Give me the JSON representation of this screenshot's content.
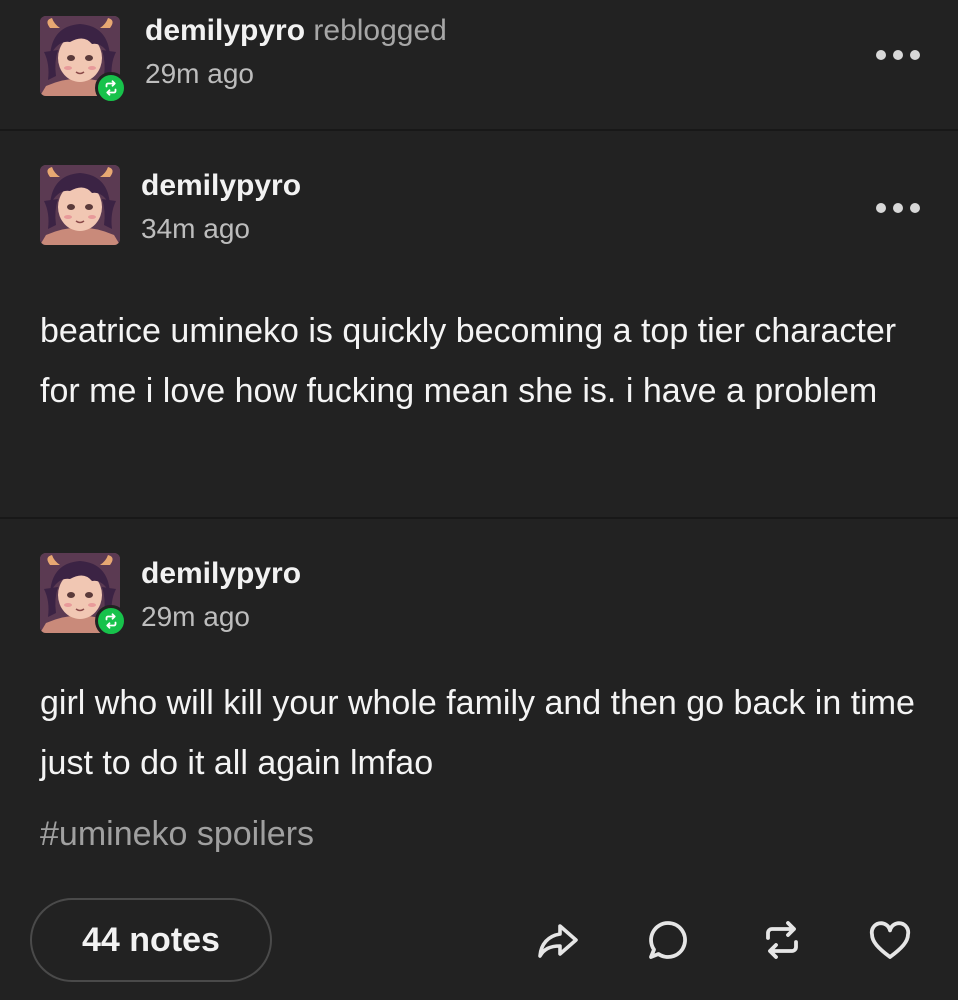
{
  "reblog_header": {
    "username": "demilypyro",
    "verb": "reblogged",
    "time": "29m ago"
  },
  "original_post": {
    "username": "demilypyro",
    "time": "34m ago",
    "body": "beatrice umineko is quickly becoming a top tier character for me i love how fucking mean she is. i have a problem"
  },
  "reblog_post": {
    "username": "demilypyro",
    "time": "29m ago",
    "body": "girl who will kill your whole family and then go back in time just to do it all again lmfao",
    "tag": "#umineko spoilers"
  },
  "footer": {
    "notes_count": "44 notes"
  },
  "colors": {
    "background": "#222222",
    "reblog_badge": "#17c24b",
    "text_primary": "#f2f2f2",
    "text_secondary": "#a7a7a7"
  },
  "icons": {
    "share": "share-arrow-icon",
    "reply": "comment-bubble-icon",
    "reblog": "reblog-icon",
    "like": "heart-icon",
    "more": "more-options-icon"
  }
}
